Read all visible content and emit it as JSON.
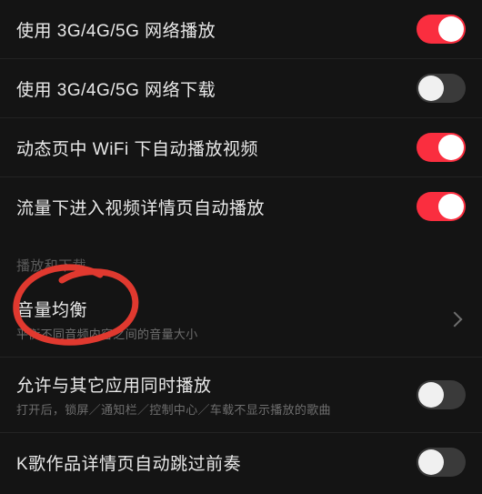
{
  "settings": {
    "group1": [
      {
        "label": "使用 3G/4G/5G 网络播放",
        "on": true
      },
      {
        "label": "使用 3G/4G/5G 网络下载",
        "on": false
      },
      {
        "label": "动态页中 WiFi 下自动播放视频",
        "on": true
      },
      {
        "label": "流量下进入视频详情页自动播放",
        "on": true
      }
    ],
    "section_header": "播放和下载",
    "volume_normalization": {
      "label": "音量均衡",
      "sub": "平衡不同音频内容之间的音量大小"
    },
    "allow_simul": {
      "label": "允许与其它应用同时播放",
      "sub": "打开后，锁屏／通知栏／控制中心／车载不显示播放的歌曲",
      "on": false
    },
    "k_skip_intro": {
      "label": "K歌作品详情页自动跳过前奏",
      "on": false
    }
  },
  "annotation": {
    "color": "#e0392f"
  }
}
